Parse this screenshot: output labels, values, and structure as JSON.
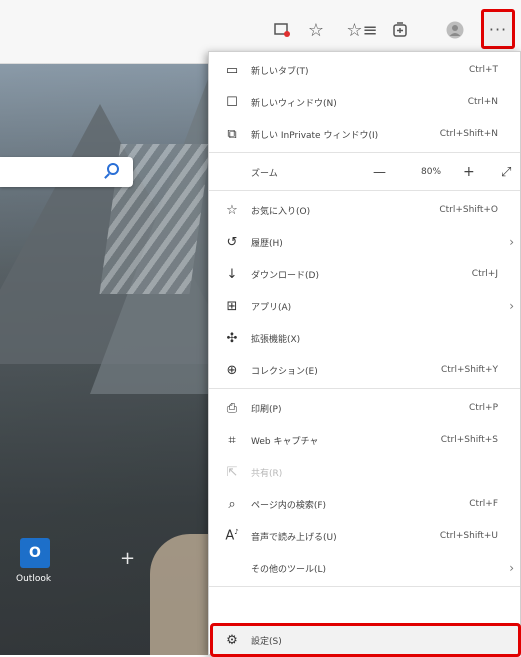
{
  "toolbar": {
    "icons": [
      "collections-red-icon",
      "star-icon",
      "favorites-bar-icon",
      "collections-icon",
      "profile-icon"
    ],
    "more_label": "···"
  },
  "background": {
    "search_placeholder": "",
    "outlook_label": "Outlook"
  },
  "menu": {
    "items": [
      {
        "name": "new-tab",
        "icon": "new-tab-icon",
        "label": "新しいタブ(T)",
        "shortcut": "Ctrl+T"
      },
      {
        "name": "new-window",
        "icon": "new-window-icon",
        "label": "新しいウィンドウ(N)",
        "shortcut": "Ctrl+N"
      },
      {
        "name": "new-inprivate",
        "icon": "inprivate-icon",
        "label": "新しい InPrivate ウィンドウ(I)",
        "shortcut": "Ctrl+Shift+N"
      },
      {
        "name": "zoom",
        "label": "ズーム",
        "value": "80%",
        "minus": "—",
        "plus": "+"
      },
      {
        "name": "favorites",
        "icon": "favorites-icon",
        "label": "お気に入り(O)",
        "shortcut": "Ctrl+Shift+O"
      },
      {
        "name": "history",
        "icon": "history-icon",
        "label": "履歴(H)",
        "shortcut": ""
      },
      {
        "name": "downloads",
        "icon": "download-icon",
        "label": "ダウンロード(D)",
        "shortcut": "Ctrl+J"
      },
      {
        "name": "apps",
        "icon": "apps-icon",
        "label": "アプリ(A)",
        "shortcut": ""
      },
      {
        "name": "extensions",
        "icon": "extensions-icon",
        "label": "拡張機能(X)",
        "shortcut": ""
      },
      {
        "name": "collections",
        "icon": "collections-icon",
        "label": "コレクション(E)",
        "shortcut": "Ctrl+Shift+Y"
      },
      {
        "name": "print",
        "icon": "print-icon",
        "label": "印刷(P)",
        "shortcut": "Ctrl+P"
      },
      {
        "name": "web-capture",
        "icon": "web-capture-icon",
        "label": "Web キャプチャ",
        "shortcut": "Ctrl+Shift+S"
      },
      {
        "name": "share",
        "icon": "share-icon",
        "label": "共有(R)",
        "shortcut": ""
      },
      {
        "name": "find-on-page",
        "icon": "find-icon",
        "label": "ページ内の検索(F)",
        "shortcut": "Ctrl+F"
      },
      {
        "name": "read-aloud",
        "icon": "read-aloud-icon",
        "label": "音声で読み上げる(U)",
        "shortcut": "Ctrl+Shift+U"
      },
      {
        "name": "more-tools",
        "label": "その他のツール(L)",
        "shortcut": ""
      },
      {
        "name": "settings",
        "icon": "gear-icon",
        "label": "設定(S)",
        "shortcut": ""
      }
    ],
    "highlight_color": "#e00000"
  }
}
